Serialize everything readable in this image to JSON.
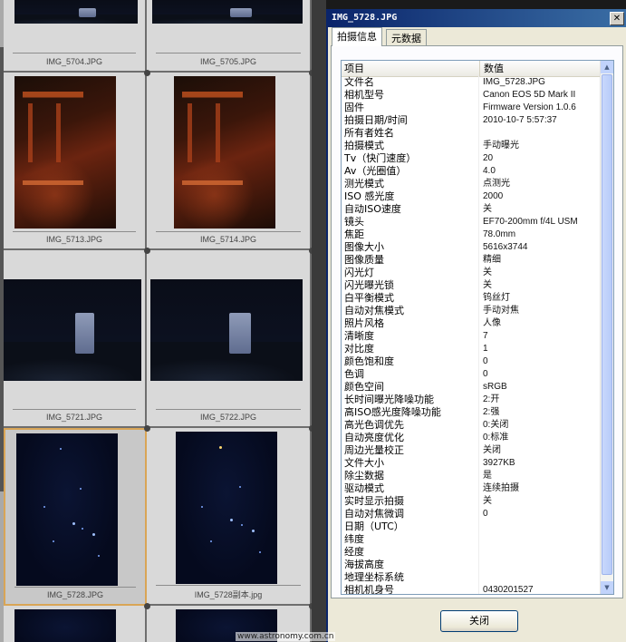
{
  "thumbnails": [
    {
      "name": "IMG_5704.JPG"
    },
    {
      "name": "IMG_5705.JPG"
    },
    {
      "name": "IMG_5713.JPG"
    },
    {
      "name": "IMG_5714.JPG"
    },
    {
      "name": "IMG_5721.JPG"
    },
    {
      "name": "IMG_5722.JPG"
    },
    {
      "name": "IMG_5728.JPG"
    },
    {
      "name": "IMG_5728副本.jpg"
    }
  ],
  "dialog": {
    "title": "IMG_5728.JPG",
    "close_glyph": "✕",
    "tabs": [
      "拍摄信息",
      "元数据"
    ],
    "header": {
      "key": "项目",
      "value": "数值"
    },
    "rows": [
      {
        "k": "文件名",
        "v": "IMG_5728.JPG"
      },
      {
        "k": "相机型号",
        "v": "Canon EOS 5D Mark II"
      },
      {
        "k": "固件",
        "v": "Firmware Version 1.0.6"
      },
      {
        "k": "拍摄日期/时间",
        "v": "2010-10-7 5:57:37"
      },
      {
        "k": "所有者姓名",
        "v": ""
      },
      {
        "k": "拍摄模式",
        "v": "手动曝光"
      },
      {
        "k": "Tv（快门速度）",
        "v": "20"
      },
      {
        "k": "Av（光圈值）",
        "v": "4.0"
      },
      {
        "k": "测光模式",
        "v": "点测光"
      },
      {
        "k": "ISO 感光度",
        "v": "2000"
      },
      {
        "k": "自动ISO速度",
        "v": "关"
      },
      {
        "k": "镜头",
        "v": "EF70-200mm f/4L USM"
      },
      {
        "k": "焦距",
        "v": "78.0mm"
      },
      {
        "k": "图像大小",
        "v": "5616x3744"
      },
      {
        "k": "图像质量",
        "v": "精细"
      },
      {
        "k": "闪光灯",
        "v": "关"
      },
      {
        "k": "闪光曝光锁",
        "v": "关"
      },
      {
        "k": "白平衡模式",
        "v": "钨丝灯"
      },
      {
        "k": "自动对焦模式",
        "v": "手动对焦"
      },
      {
        "k": "照片风格",
        "v": "人像"
      },
      {
        "k": "清晰度",
        "v": "7"
      },
      {
        "k": "对比度",
        "v": "1"
      },
      {
        "k": "颜色饱和度",
        "v": "0"
      },
      {
        "k": "色调",
        "v": "0"
      },
      {
        "k": "颜色空间",
        "v": "sRGB"
      },
      {
        "k": "长时间曝光降噪功能",
        "v": "2:开"
      },
      {
        "k": "高ISO感光度降噪功能",
        "v": "2:强"
      },
      {
        "k": "高光色调优先",
        "v": "0:关闭"
      },
      {
        "k": "自动亮度优化",
        "v": "0:标准"
      },
      {
        "k": "周边光量校正",
        "v": "关闭"
      },
      {
        "k": "文件大小",
        "v": "3927KB"
      },
      {
        "k": "除尘数据",
        "v": "是"
      },
      {
        "k": "驱动模式",
        "v": "连续拍摄"
      },
      {
        "k": "实时显示拍摄",
        "v": "关"
      },
      {
        "k": "自动对焦微调",
        "v": "0"
      },
      {
        "k": "日期（UTC）",
        "v": ""
      },
      {
        "k": "纬度",
        "v": ""
      },
      {
        "k": "经度",
        "v": ""
      },
      {
        "k": "海拔高度",
        "v": ""
      },
      {
        "k": "地理坐标系统",
        "v": ""
      },
      {
        "k": "相机机身号",
        "v": "0430201527"
      }
    ],
    "close_button": "关闭"
  },
  "watermark": "www.astronomy.com.cn",
  "colors": {
    "titlebar": "#0a246a",
    "dialog_bg": "#ece9d8",
    "selected_border": "#d9a556"
  }
}
